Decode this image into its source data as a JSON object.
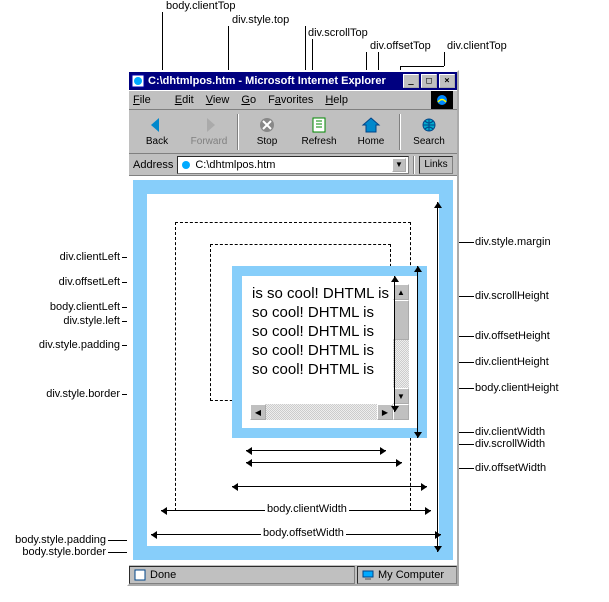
{
  "callouts": {
    "top": {
      "bodyClientTop": "body.clientTop",
      "divStyleTop": "div.style.top",
      "divScrollTop": "div.scrollTop",
      "divOffsetTop": "div.offsetTop",
      "divClientTop": "div.clientTop"
    },
    "left": {
      "divClientLeft": "div.clientLeft",
      "divOffsetLeft": "div.offsetLeft",
      "bodyClientLeft": "body.clientLeft",
      "divStyleLeft": "div.style.left",
      "divStylePadding": "div.style.padding",
      "divStyleBorder": "div.style.border",
      "bodyStylePadding": "body.style.padding",
      "bodyStyleBorder": "body.style.border"
    },
    "right": {
      "divStyleMargin": "div.style.margin",
      "divScrollHeight": "div.scrollHeight",
      "divOffsetHeight": "div.offsetHeight",
      "divClientHeight": "div.clientHeight",
      "bodyClientHeight": "body.clientHeight"
    },
    "bottom": {
      "divClientWidth": "div.clientWidth",
      "divScrollWidth": "div.scrollWidth",
      "divOffsetWidth": "div.offsetWidth",
      "bodyClientWidth": "body.clientWidth",
      "bodyOffsetWidth": "body.offsetWidth"
    }
  },
  "window": {
    "title": "C:\\dhtmlpos.htm - Microsoft Internet Explorer"
  },
  "menu": {
    "file": "File",
    "edit": "Edit",
    "view": "View",
    "go": "Go",
    "favorites": "Favorites",
    "help": "Help"
  },
  "toolbar": {
    "back": "Back",
    "forward": "Forward",
    "stop": "Stop",
    "refresh": "Refresh",
    "home": "Home",
    "search": "Search"
  },
  "address": {
    "label": "Address",
    "value": "C:\\dhtmlpos.htm",
    "links": "Links"
  },
  "content": {
    "text": "is so cool!\nDHTML is so cool! DHTML is so cool! DHTML is so cool! DHTML is so cool! DHTML is"
  },
  "status": {
    "done": "Done",
    "zone": "My Computer"
  },
  "colors": {
    "blue": "#87cefa",
    "chrome": "#c0c0c0",
    "titlebar": "#000080"
  }
}
